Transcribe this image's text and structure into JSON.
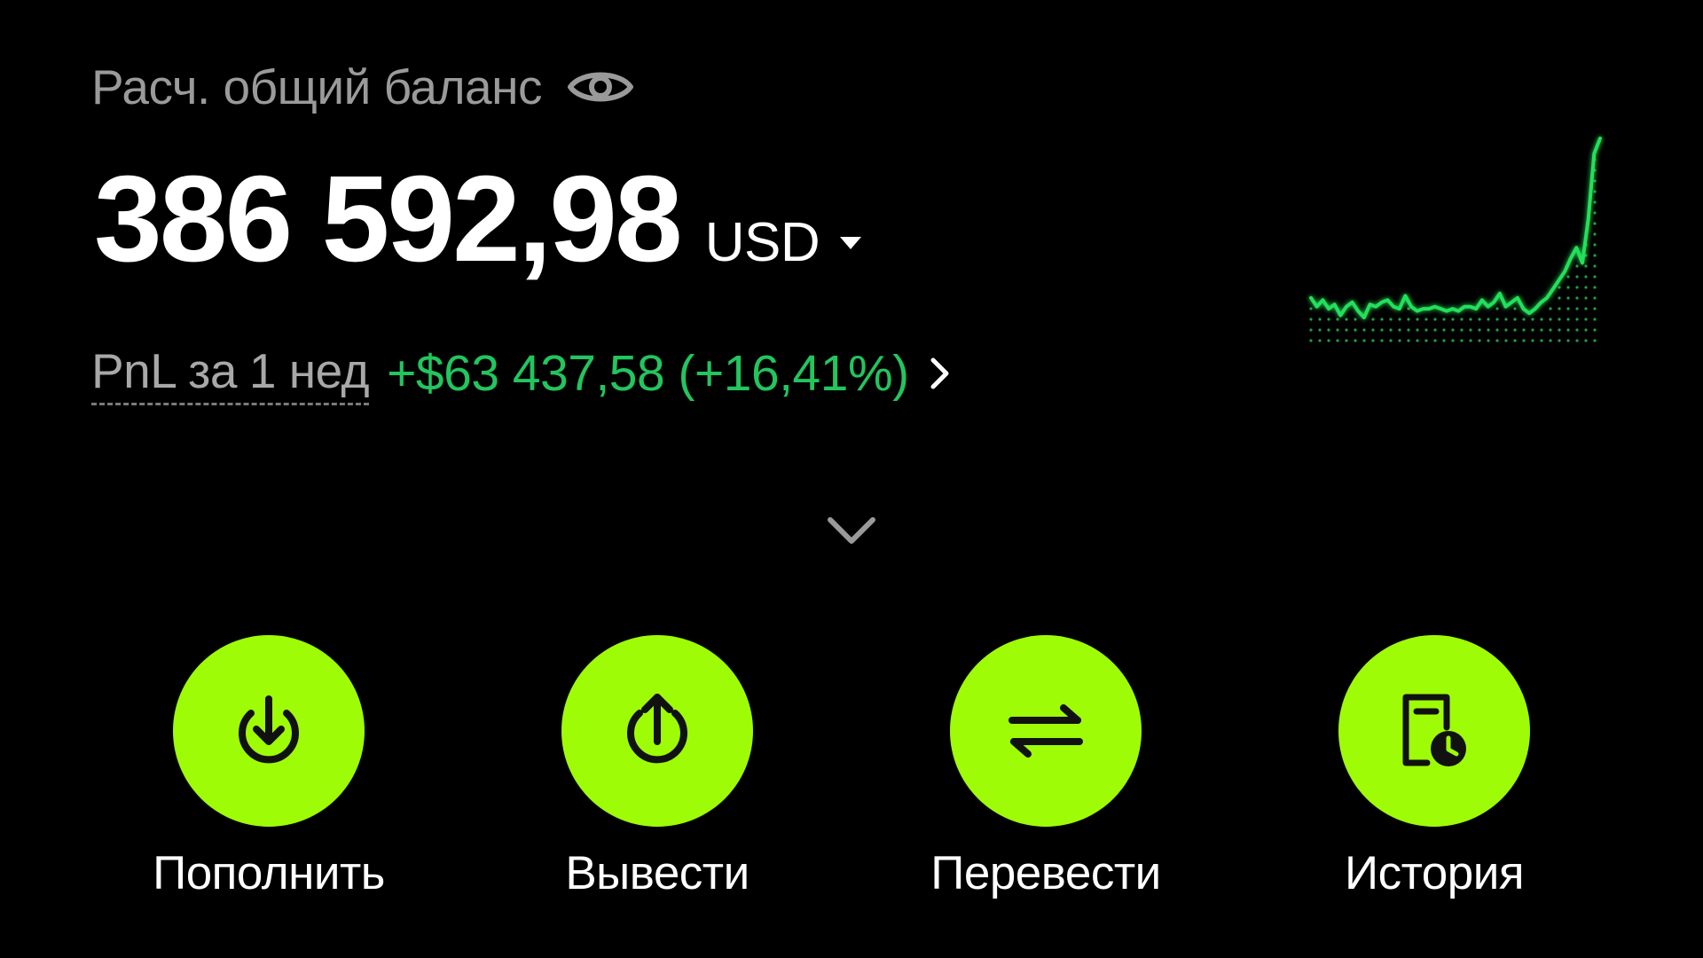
{
  "balance": {
    "label": "Расч. общий баланс",
    "amount": "386 592,98",
    "currency": "USD"
  },
  "pnl": {
    "label": "PnL за",
    "period": "1 нед",
    "value": "+$63 437,58 (+16,41%)"
  },
  "sparkline": {
    "values": [
      22,
      18,
      21,
      17,
      19,
      14,
      18,
      20,
      16,
      13,
      19,
      18,
      20,
      21,
      18,
      17,
      23,
      18,
      16,
      17,
      17,
      18,
      17,
      16,
      17,
      16,
      18,
      18,
      17,
      21,
      18,
      20,
      24,
      18,
      20,
      22,
      17,
      15,
      17,
      20,
      22,
      26,
      30,
      34,
      40,
      45,
      38,
      58,
      88,
      95
    ]
  },
  "actions": [
    {
      "label": "Пополнить",
      "icon": "deposit-icon"
    },
    {
      "label": "Вывести",
      "icon": "withdraw-icon"
    },
    {
      "label": "Перевести",
      "icon": "transfer-icon"
    },
    {
      "label": "История",
      "icon": "history-icon"
    }
  ],
  "colors": {
    "background": "#000000",
    "accent": "#9efc07",
    "positive": "#22c55e",
    "muted_text": "#9a9a9a",
    "icon_dark": "#111111"
  }
}
